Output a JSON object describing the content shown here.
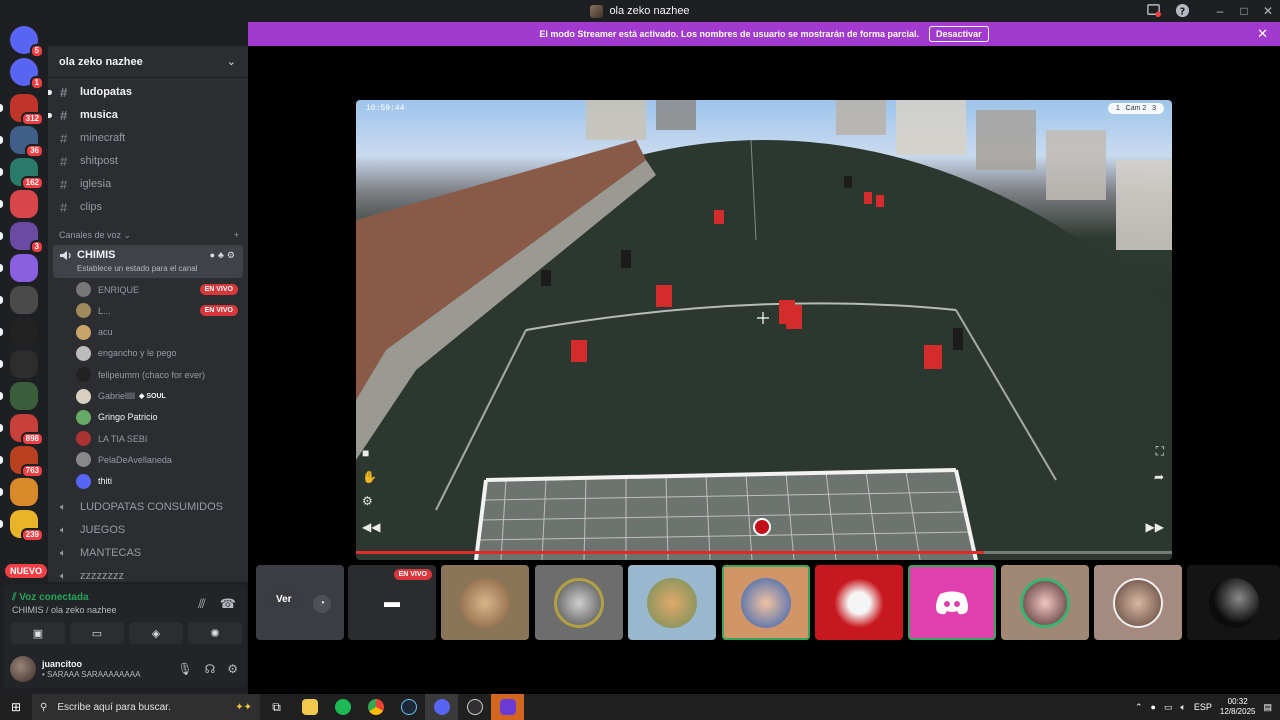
{
  "window": {
    "title": "ola zeko nazhee"
  },
  "banner": {
    "text": "El modo Streamer está activado. Los nombres de usuario se mostrarán de forma parcial.",
    "button": "Desactivar"
  },
  "servers": [
    {
      "icon": "discord-dm-icon",
      "badge": "5"
    },
    {
      "icon": "discord-icon",
      "badge": "1"
    },
    {
      "icon": "server-icon",
      "badge": "312"
    },
    {
      "icon": "server-icon",
      "badge": "36"
    },
    {
      "icon": "server-icon",
      "badge": "162"
    },
    {
      "icon": "server-icon",
      "badge": ""
    },
    {
      "icon": "server-icon",
      "badge": "3"
    },
    {
      "icon": "server-icon",
      "badge": ""
    },
    {
      "icon": "server-icon",
      "badge": ""
    },
    {
      "icon": "server-icon",
      "badge": ""
    },
    {
      "icon": "server-icon",
      "badge": ""
    },
    {
      "icon": "server-icon",
      "badge": ""
    },
    {
      "icon": "server-icon",
      "badge": "898"
    },
    {
      "icon": "server-icon",
      "badge": "763"
    },
    {
      "icon": "server-icon",
      "badge": ""
    },
    {
      "icon": "server-icon",
      "badge": "239"
    }
  ],
  "nuevo": "NUEVO",
  "sidebar": {
    "server_name": "ola zeko nazhee",
    "text_channels": [
      {
        "name": "ludopatas",
        "unread": true
      },
      {
        "name": "musica",
        "unread": true
      },
      {
        "name": "minecraft",
        "unread": false
      },
      {
        "name": "shitpost",
        "unread": false
      },
      {
        "name": "iglesia",
        "unread": false
      },
      {
        "name": "clips",
        "unread": false
      }
    ],
    "voice_category": "Canales de voz",
    "active_voice": {
      "name": "CHIMIS",
      "status_hint": "Establece un estado para el canal"
    },
    "voice_users": [
      {
        "name": "ENRIQUE",
        "live": "EN VIVO",
        "extra": ""
      },
      {
        "name": "L...",
        "live": "EN VIVO",
        "extra": ""
      },
      {
        "name": "acu",
        "live": "",
        "extra": ""
      },
      {
        "name": "engancho y le pego",
        "live": "",
        "extra": ""
      },
      {
        "name": "felipeumm (chaco for ever)",
        "live": "",
        "extra": ""
      },
      {
        "name": "Gabrielllll",
        "live": "",
        "extra": "SOUL"
      },
      {
        "name": "Gringo Patricio",
        "live": "",
        "extra": ""
      },
      {
        "name": "LA TIA SEBI",
        "live": "",
        "extra": ""
      },
      {
        "name": "PelaDeAvellaneda",
        "live": "",
        "extra": ""
      },
      {
        "name": "thiti",
        "live": "",
        "extra": ""
      }
    ],
    "other_voice_channels": [
      "LUDOPATAS CONSUMIDOS",
      "JUEGOS",
      "MANTECAS",
      "zzzzzzzz"
    ]
  },
  "voice_panel": {
    "status": "Voz conectada",
    "channel": "CHIMIS / ola zeko nazhee",
    "username": "juancitoo",
    "user_status": "• SARAAA SARAAAAAAAA"
  },
  "video": {
    "timestamp": "10:59:44",
    "cam_tag": "Cam 2",
    "progress": 0.77
  },
  "tiles": {
    "ver_label": "Ver",
    "live_label": "EN VIVO"
  },
  "taskbar": {
    "search_placeholder": "Escribe aquí para buscar.",
    "lang": "ESP",
    "time": "00:32",
    "date": "12/8/2025"
  },
  "colors": {
    "banner": "#a33ad0",
    "live": "#da373c",
    "connected": "#23a55a"
  }
}
